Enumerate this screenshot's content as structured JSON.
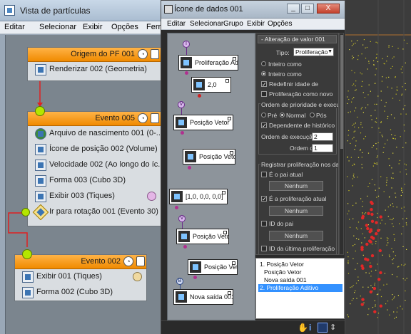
{
  "main_window": {
    "title": "Vista de partículas",
    "menu": [
      "Editar",
      "Selecionar",
      "Exibir",
      "Opções",
      "Ferra"
    ]
  },
  "events": [
    {
      "title": "Origem do PF 001",
      "rows": [
        {
          "icon": "render-icon",
          "label": "Renderizar 002 (Geometria)"
        }
      ]
    },
    {
      "title": "Evento 005",
      "rows": [
        {
          "icon": "birth-file-icon",
          "label": "Arquivo de nascimento 001 (0-..."
        },
        {
          "icon": "position-icon",
          "label": "Ícone de posição 002 (Volume)"
        },
        {
          "icon": "speed-icon",
          "label": "Velocidade 002 (Ao longo do íc..."
        },
        {
          "icon": "shape-icon",
          "label": "Forma 003 (Cubo 3D)"
        },
        {
          "icon": "display-icon",
          "label": "Exibir 003 (Tiques)"
        },
        {
          "icon": "test-icon",
          "label": "Ir para rotação 001 (Evento 30)"
        }
      ]
    },
    {
      "title": "Evento 002",
      "rows": [
        {
          "icon": "display-icon",
          "label": "Exibir 001 (Tiques)"
        },
        {
          "icon": "shape-icon",
          "label": "Forma 002 (Cubo 3D)"
        }
      ]
    }
  ],
  "icon_window": {
    "title": "Ícone de dados 001",
    "menu": [
      "Editar",
      "Selecionar",
      "Grupo",
      "Exibir",
      "Opções"
    ],
    "win_buttons": [
      "_",
      "□",
      "X"
    ]
  },
  "data_icons": [
    {
      "label": "Proliferação Adi...",
      "pin": "I"
    },
    {
      "label": "2,0",
      "pin": ""
    },
    {
      "label": "Posição Vetor",
      "pin": "V"
    },
    {
      "label": "Posição Vetor",
      "pin": ""
    },
    {
      "label": "[1,0, 0,0, 0,0]",
      "pin": ""
    },
    {
      "label": "Posição Vetor",
      "pin": "V"
    },
    {
      "label": "Posição Vetor",
      "pin": ""
    },
    {
      "label": "Nova saída 001",
      "pin": "B"
    }
  ],
  "props": {
    "rollout_title": "- Alteração de valor 001",
    "tipo_label": "Tipo:",
    "tipo_value": "Proliferação",
    "radio_inteiro_1": "Inteiro como",
    "radio_inteiro_2": "Inteiro como",
    "check_redefinir": "Redefinir idade de",
    "check_proliferacao_novo": "Proliferação como novo",
    "group_prioridade": "Ordem de prioridade e execu",
    "radio_pre": "Pré",
    "radio_normal": "Normal",
    "radio_pos": "Pós",
    "check_dependente": "Dependente de histórico",
    "ordem_execucao_label": "Ordem de execução:",
    "ordem_execucao_value": "2",
    "ordem_label": "Ordem de",
    "ordem_value": "1",
    "group_registrar": "Registrar proliferação nos da",
    "check_pai": "É o pai atual",
    "btn_nenhum_1": "Nenhum",
    "check_proliferacao_atual": "É a proliferação atual",
    "btn_nenhum_2": "Nenhum",
    "check_id_pai": "ID do pai",
    "btn_nenhum_3": "Nenhum",
    "check_id_ultima": "ID da última proliferação"
  },
  "listbox": [
    "1. Posição Vetor",
    "Posição Vetor",
    "Nova saída 001",
    "2. Proliferação Aditivo"
  ],
  "colors": {
    "event_header": "#f08a00",
    "input_dot": "#b4e600",
    "wire_red": "#e02020",
    "selection": "#3391ff"
  }
}
